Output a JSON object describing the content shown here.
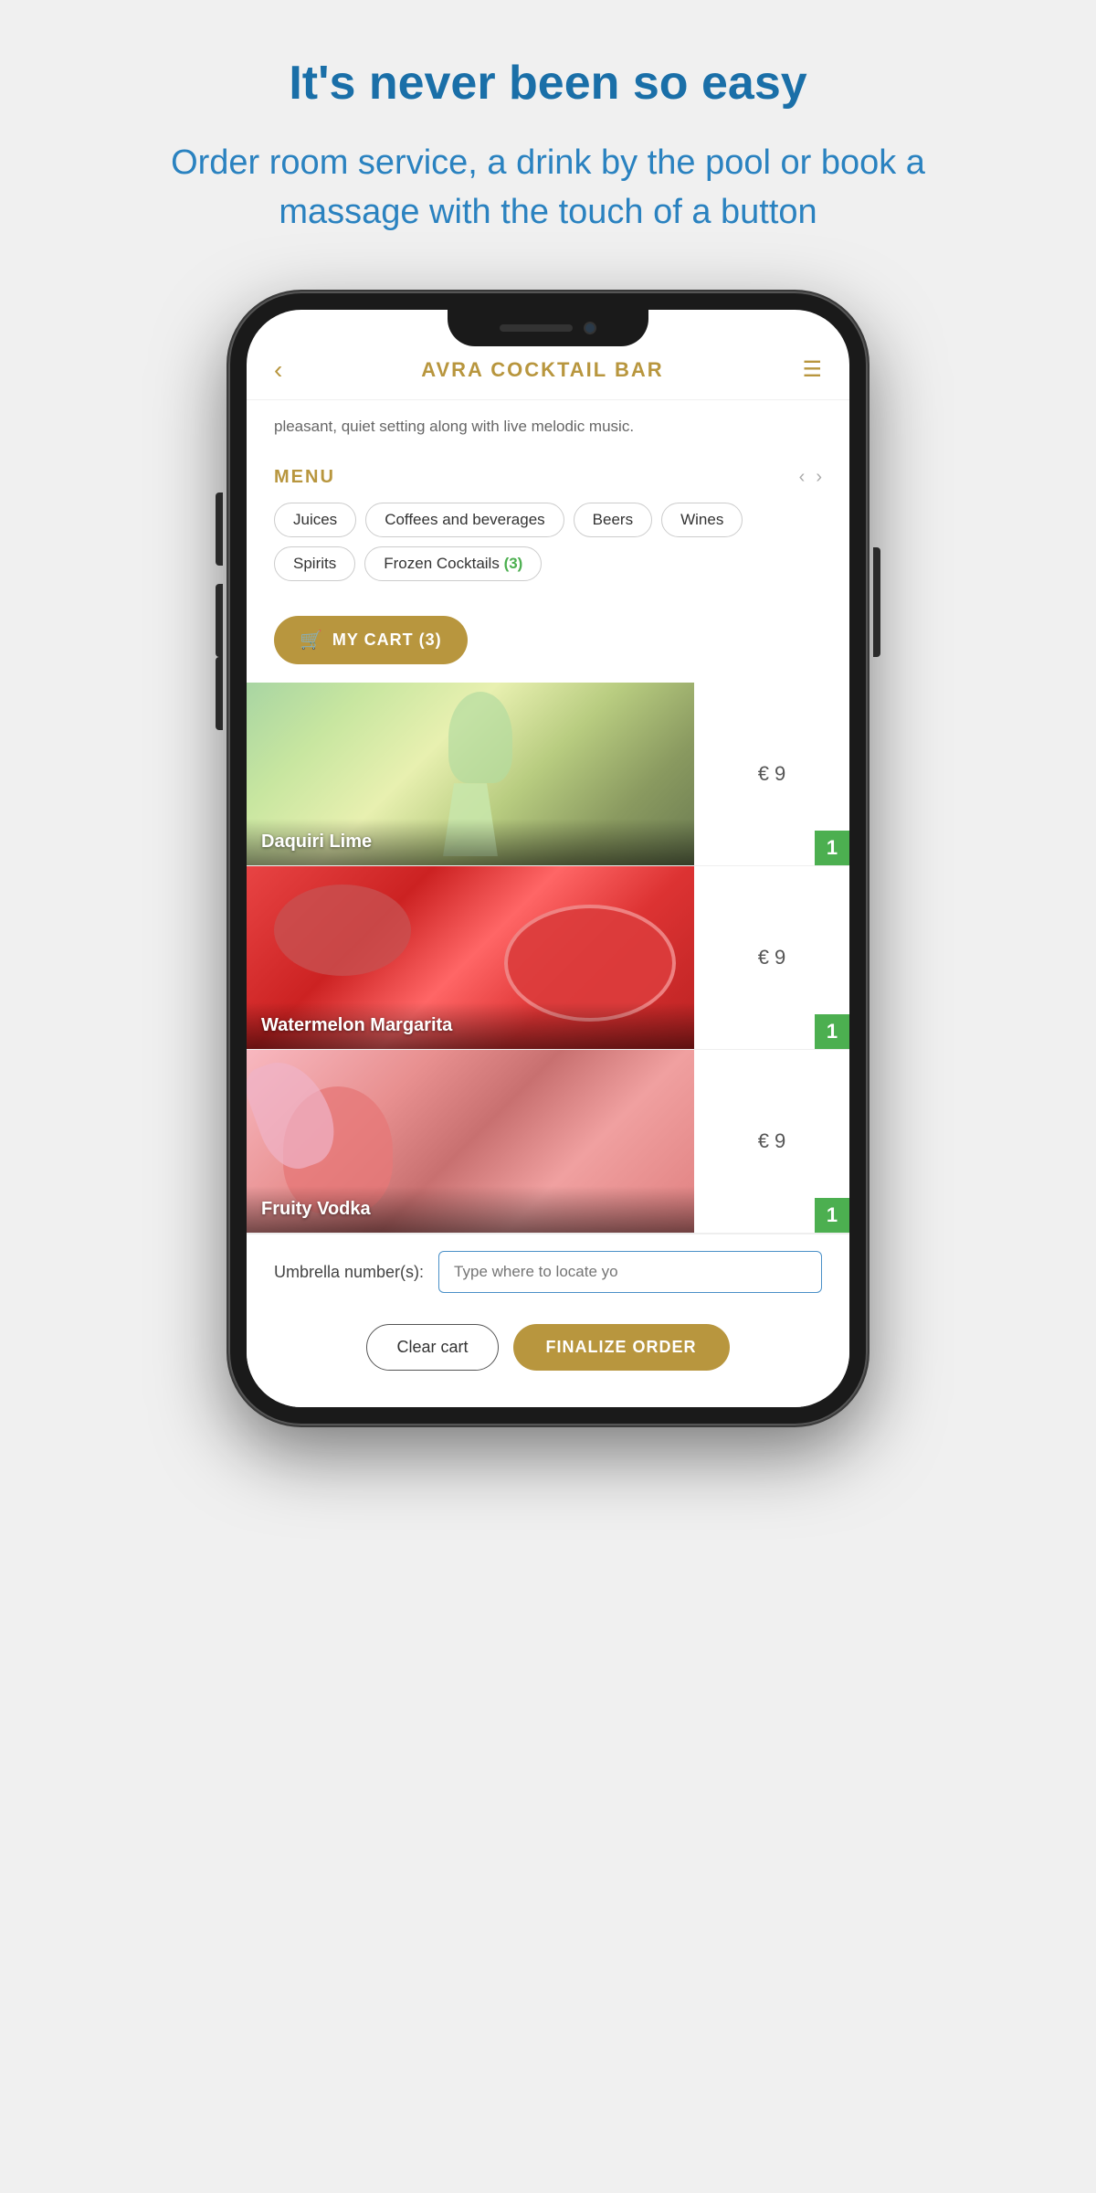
{
  "page": {
    "headline": "It's never been so easy",
    "subheadline": "Order room service, a drink by the pool or book a massage with the touch of a button"
  },
  "app": {
    "bar_name": "AVRA COCKTAIL BAR",
    "description": "pleasant, quiet setting along with live melodic music.",
    "menu_label": "MENU",
    "cart_button": "MY CART (3)",
    "categories": [
      {
        "label": "Juices",
        "active": false,
        "badge": null
      },
      {
        "label": "Coffees and beverages",
        "active": false,
        "badge": null
      },
      {
        "label": "Beers",
        "active": false,
        "badge": null
      },
      {
        "label": "Wines",
        "active": false,
        "badge": null
      },
      {
        "label": "Spirits",
        "active": false,
        "badge": null
      },
      {
        "label": "Frozen Cocktails",
        "active": false,
        "badge": "(3)"
      }
    ],
    "items": [
      {
        "name": "Daquiri Lime",
        "price": "€ 9",
        "qty": "1",
        "img_type": "daquiri"
      },
      {
        "name": "Watermelon Margarita",
        "price": "€ 9",
        "qty": "1",
        "img_type": "watermelon"
      },
      {
        "name": "Fruity Vodka",
        "price": "€ 9",
        "qty": "1",
        "img_type": "fruity"
      }
    ],
    "umbrella_label": "Umbrella number(s):",
    "umbrella_placeholder": "Type where to locate yo",
    "clear_cart_label": "Clear cart",
    "finalize_label": "FINALIZE ORDER"
  }
}
